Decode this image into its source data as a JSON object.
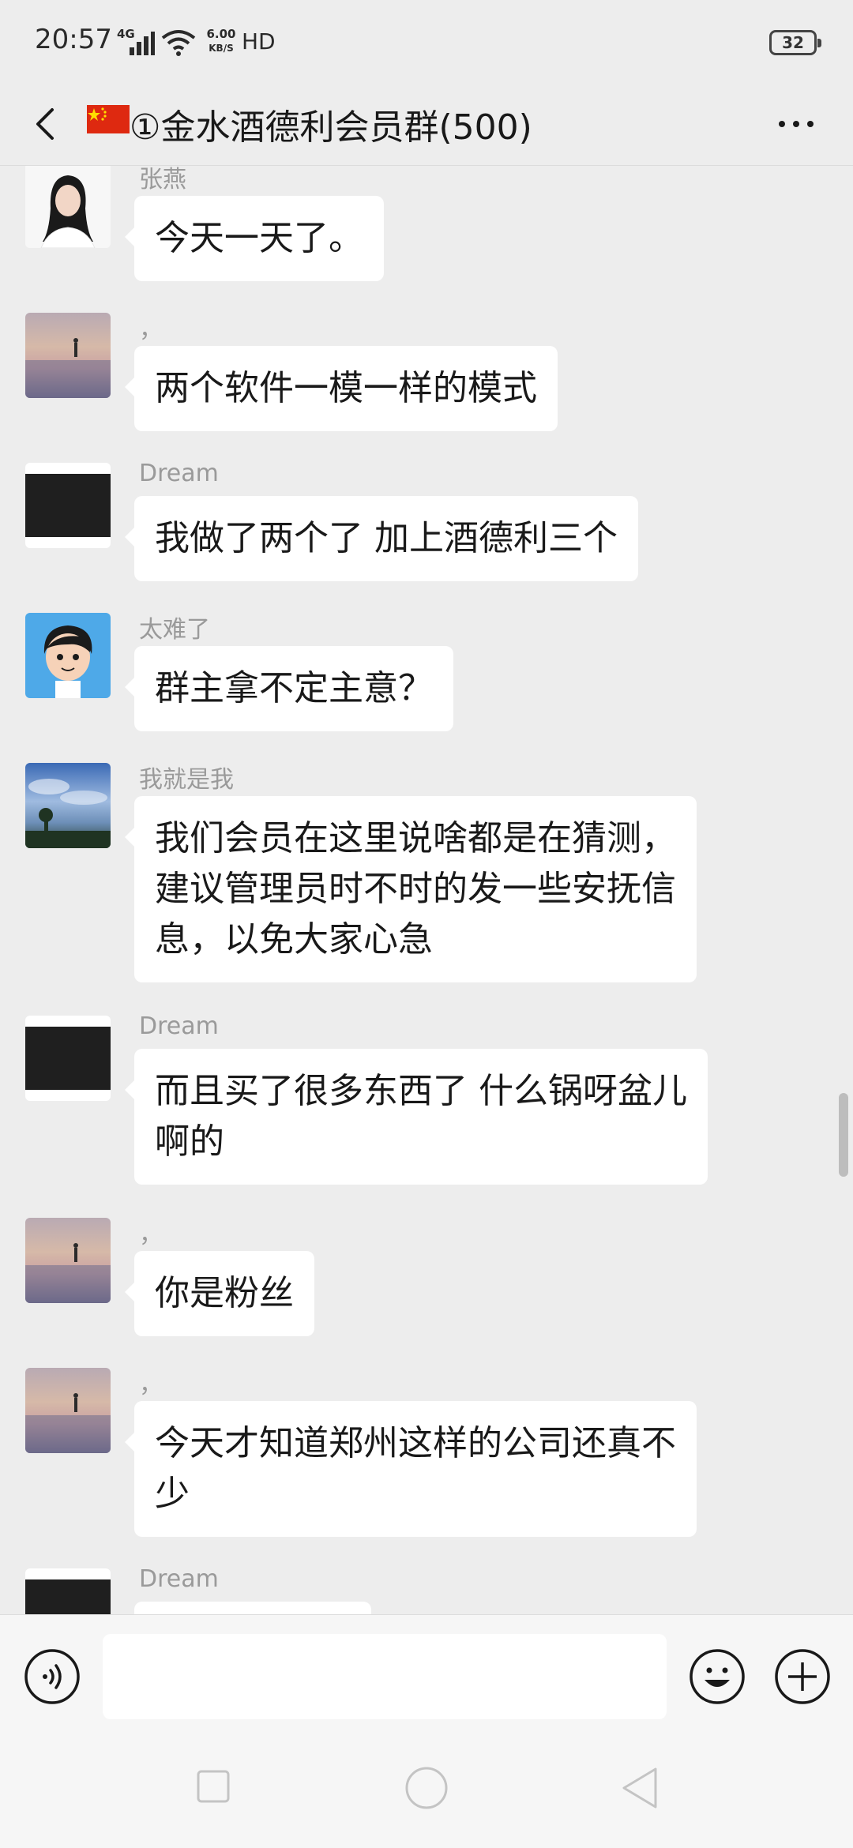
{
  "status_bar": {
    "time": "20:57",
    "network": "4G",
    "speed_value": "6.00",
    "speed_unit": "KB/S",
    "hd": "HD",
    "battery": "32"
  },
  "header": {
    "title": "①金水酒德利会员群(500)",
    "back_icon": "chevron-left-icon",
    "more_icon": "more-dots-icon",
    "flag_icon": "china-flag-icon"
  },
  "messages": [
    {
      "sender": "张燕",
      "text": "今天一天了。",
      "avatar": "woman-portrait"
    },
    {
      "sender": "，",
      "text": "两个软件一模一样的模式",
      "avatar": "beach-silhouette"
    },
    {
      "sender": "Dream",
      "text": "我做了两个了 加上酒德利三个",
      "avatar": "dark-text-image"
    },
    {
      "sender": "太难了",
      "text": "群主拿不定主意？",
      "avatar": "cartoon-boy"
    },
    {
      "sender": "我就是我",
      "text_lines": [
        "我们会员在这里说啥都是在猜测，",
        "建议管理员时不时的发一些安抚信",
        "息，以免大家心急"
      ],
      "avatar": "sky-landscape"
    },
    {
      "sender": "Dream",
      "text_lines": [
        "而且买了很多东西了 什么锅呀盆儿",
        "啊的"
      ],
      "avatar": "dark-text-image"
    },
    {
      "sender": "，",
      "text": "你是粉丝",
      "avatar": "beach-silhouette"
    },
    {
      "sender": "，",
      "text_lines": [
        "今天才知道郑州这样的公司还真不",
        "少"
      ],
      "avatar": "beach-silhouette"
    },
    {
      "sender": "Dream",
      "text": "",
      "avatar": "dark-text-image"
    }
  ],
  "input_bar": {
    "placeholder": "",
    "voice_icon": "voice-icon",
    "emoji_icon": "emoji-icon",
    "plus_icon": "plus-icon"
  },
  "nav_bar": {
    "recents_icon": "square-icon",
    "home_icon": "circle-icon",
    "back_icon": "triangle-back-icon"
  },
  "colors": {
    "background": "#ededed",
    "bubble": "#ffffff",
    "sender_name": "#9a9a9a",
    "text": "#191919",
    "flag_red": "#de2910",
    "flag_star": "#ffde00"
  }
}
